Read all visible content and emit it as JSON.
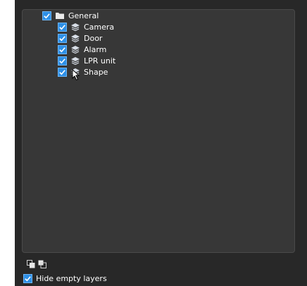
{
  "tree": {
    "root": {
      "label": "General",
      "checked": true,
      "icon": "folder-icon"
    },
    "children": [
      {
        "label": "Camera",
        "checked": true,
        "icon": "layer-icon"
      },
      {
        "label": "Door",
        "checked": true,
        "icon": "layer-icon"
      },
      {
        "label": "Alarm",
        "checked": true,
        "icon": "layer-icon"
      },
      {
        "label": "LPR unit",
        "checked": true,
        "icon": "layer-icon"
      },
      {
        "label": "Shape",
        "checked": true,
        "icon": "layer-icon"
      }
    ]
  },
  "footer": {
    "buttons": [
      {
        "icon": "bring-to-front-icon"
      },
      {
        "icon": "send-to-back-icon"
      }
    ],
    "hide_empty_layers": {
      "label": "Hide empty layers",
      "checked": true
    }
  },
  "colors": {
    "panel_bg": "#282828",
    "tree_bg": "#373737",
    "checkbox_blue": "#2d8fe6"
  }
}
